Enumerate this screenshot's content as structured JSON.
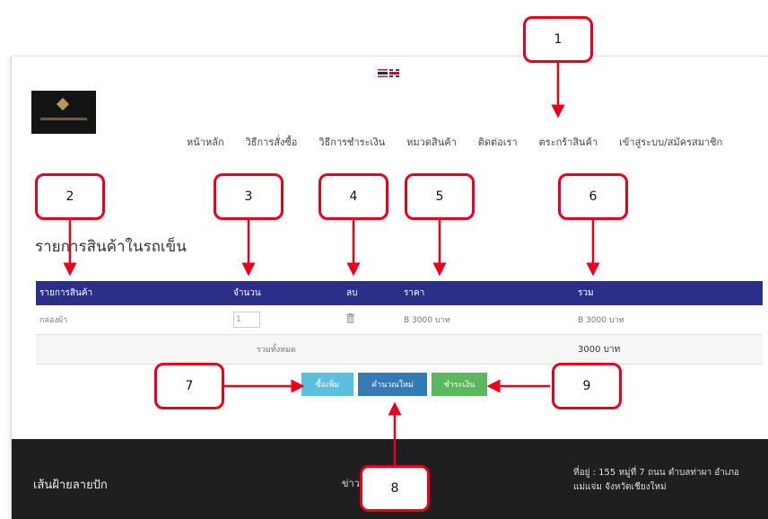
{
  "languages": [
    "Thai",
    "English"
  ],
  "nav": {
    "items": [
      "หน้าหลัก",
      "วิธีการสั่งซื้อ",
      "วิธีการชำระเงิน",
      "หมวดสินค้า",
      "ติดต่อเรา",
      "ตระกร้าสินค้า",
      "เข้าสู่ระบบ/สมัครสมาชิก"
    ]
  },
  "cart": {
    "title": "รายการสินค้าในรถเข็น",
    "headers": {
      "product": "รายการสินค้า",
      "quantity": "จำนวน",
      "delete": "ลบ",
      "price": "ราคา",
      "total": "รวม"
    },
    "rows": [
      {
        "product": "กล่องผ้า",
        "quantity": "1",
        "price_currency": "B",
        "price_value": "3000 บาท",
        "total_currency": "B",
        "total_value": "3000 บาท"
      }
    ],
    "grand_total_label": "รวมทั้งหมด",
    "grand_total_value": "3000 บาท"
  },
  "buttons": {
    "continue_shopping": "ซื้อเพิ่ม",
    "recalculate": "คำนวณใหม่",
    "checkout": "ชำระเงิน"
  },
  "footer": {
    "brand": "เส้นฝ้ายลายปัก",
    "news_label": "ข่าว",
    "address": "ที่อยู่ : 155 หมู่ที่ 7 ถนน ตำบลท่าผา อำเภอแม่แจ่ม จังหวัดเชียงใหม่"
  },
  "callouts": [
    "1",
    "2",
    "3",
    "4",
    "5",
    "6",
    "7",
    "8",
    "9"
  ],
  "colors": {
    "table_header": "#2b2f87",
    "callout_border": "#e8001c",
    "btn_more": "#5bc0de",
    "btn_recalc": "#337ab7",
    "btn_pay": "#5cb85c",
    "footer_bg": "#1f1f1f"
  }
}
